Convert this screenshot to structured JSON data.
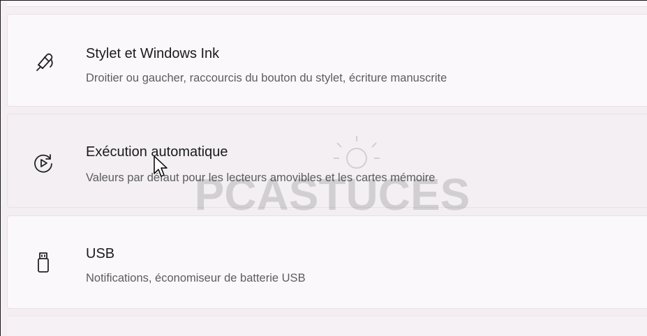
{
  "items": [
    {
      "icon": "pen-icon",
      "title": "Stylet et Windows Ink",
      "description": "Droitier ou gaucher, raccourcis du bouton du stylet, écriture manuscrite"
    },
    {
      "icon": "autoplay-icon",
      "title": "Exécution automatique",
      "description": "Valeurs par défaut pour les lecteurs amovibles et les cartes mémoire"
    },
    {
      "icon": "usb-icon",
      "title": "USB",
      "description": "Notifications, économiseur de batterie USB"
    }
  ],
  "watermark": "PCASTUCES",
  "colors": {
    "background": "#f5eef3",
    "card": "#fbf8fb",
    "card_hover": "#f3eff3",
    "title": "#1b1b1b",
    "description": "#5d5d5d"
  }
}
